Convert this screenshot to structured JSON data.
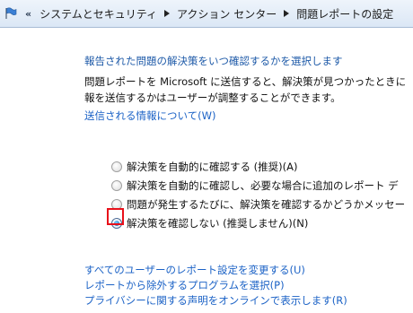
{
  "address_bar": {
    "chevron": "«",
    "breadcrumbs": [
      "システムとセキュリティ",
      "アクション センター",
      "問題レポートの設定"
    ]
  },
  "main": {
    "heading": "報告された問題の解決策をいつ確認するかを選択します",
    "description_lines": [
      "問題レポートを Microsoft に送信すると、解決策が見つかったときに",
      "報を送信するかはユーザーが調整することができます。"
    ],
    "info_link": "送信される情報について(W)",
    "options": [
      {
        "label": "解決策を自動的に確認する (推奨)(A)",
        "checked": false
      },
      {
        "label": "解決策を自動的に確認し、必要な場合に追加のレポート デ",
        "checked": false
      },
      {
        "label": "問題が発生するたびに、解決策を確認するかどうかメッセー",
        "checked": false
      },
      {
        "label": "解決策を確認しない (推奨しません)(N)",
        "checked": true
      }
    ],
    "bottom_links": [
      "すべてのユーザーのレポート設定を変更する(U)",
      "レポートから除外するプログラムを選択(P)",
      "プライバシーに関する声明をオンラインで表示します(R)"
    ]
  },
  "colors": {
    "link": "#1b62c6",
    "heading": "#1e5aa8",
    "highlight": "#e8101a"
  }
}
